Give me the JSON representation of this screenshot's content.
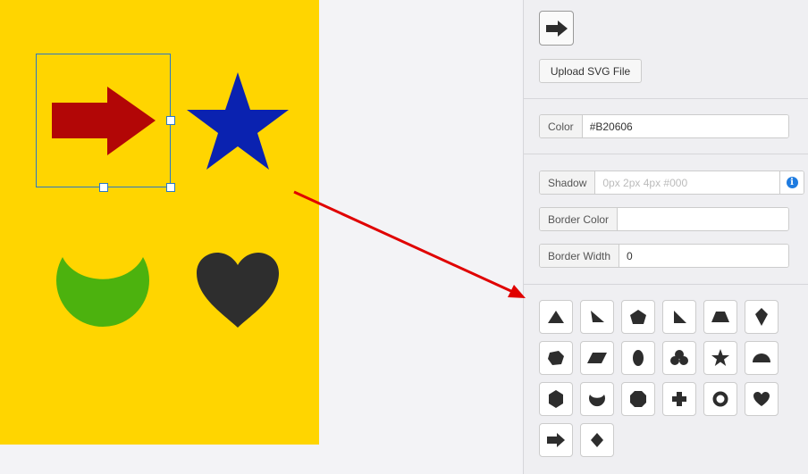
{
  "canvas": {
    "background": "#FFD500",
    "shapes": [
      {
        "name": "arrow",
        "color": "#B20606",
        "selected": true
      },
      {
        "name": "star",
        "color": "#0A22B0"
      },
      {
        "name": "moon",
        "color": "#4CB20E"
      },
      {
        "name": "heart",
        "color": "#2E2E2E"
      }
    ]
  },
  "annotation_arrow_color": "#E00000",
  "panel": {
    "preview_icon": "arrow-right-icon",
    "upload_label": "Upload SVG File",
    "color": {
      "label": "Color",
      "value": "#B20606"
    },
    "shadow": {
      "label": "Shadow",
      "value": "",
      "placeholder": "0px 2px 4px #000"
    },
    "border_color": {
      "label": "Border Color",
      "value": ""
    },
    "border_width": {
      "label": "Border Width",
      "value": "0"
    },
    "shapes": [
      "triangle-icon",
      "right-triangle-icon",
      "pentagon-icon",
      "corner-triangle-icon",
      "trapezoid-icon",
      "kite-icon",
      "irregular-polygon-icon",
      "parallelogram-icon",
      "ellipse-icon",
      "club-icon",
      "star-icon",
      "semicircle-icon",
      "hexagon-icon",
      "moon-icon",
      "octagon-icon",
      "cross-icon",
      "ring-icon",
      "heart-icon",
      "arrow-right-icon",
      "diamond-icon"
    ]
  }
}
